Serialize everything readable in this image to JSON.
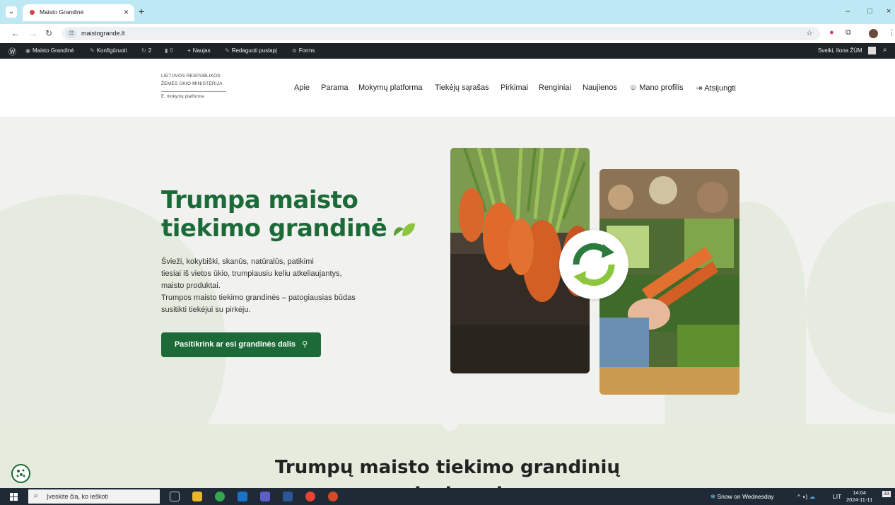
{
  "browser": {
    "tab_title": "Maisto Grandinė",
    "tab_close": "×",
    "new_tab": "+",
    "url": "maistogrande.lt",
    "controls": {
      "minimize": "–",
      "maximize": "□",
      "close": "×"
    }
  },
  "admin_bar": {
    "site_name": "Maisto Grandinė",
    "customize": "Konfigūruoti",
    "updates_count": "2",
    "comments_count": "0",
    "new_label": "Naujas",
    "edit_page": "Redaguoti puslapį",
    "forms": "Forms",
    "greeting": "Sveiki, Ilona ŽŪM"
  },
  "header": {
    "logo_line1": "LIETUVOS RESPUBLIKOS",
    "logo_line2": "ŽEMĖS ŪKIO MINISTERIJA",
    "logo_sub": "E. mokymų platforma",
    "nav": [
      "Apie",
      "Parama",
      "Mokymų platforma",
      "Tiekėjų sąrašas",
      "Pirkimai",
      "Renginiai",
      "Naujienos",
      "Mano profilis",
      "Atsijungti"
    ]
  },
  "hero": {
    "title_line1": "Trumpa maisto",
    "title_line2": "tiekimo grandinė",
    "text_lines": [
      "Švieži, kokybiški, skanūs, natūralūs, patikimi",
      "tiesiai iš vietos ūkio, trumpiausiu keliu atkeliaujantys,",
      "maisto produktai.",
      "Trumpos maisto tiekimo grandinės – patogiausias būdas",
      "susitikti tiekėjui su pirkėju."
    ],
    "cta_label": "Pasitikrink ar esi grandinės dalis"
  },
  "section2": {
    "title_line1": "Trumpų maisto tiekimo grandinių",
    "title_line2": "privalumai"
  },
  "taskbar": {
    "search_placeholder": "Įveskite čia, ko ieškoti",
    "weather": "Snow on Wednesday",
    "lang": "LIT",
    "time": "14:04",
    "date": "2024-11-11",
    "notifications": "33"
  },
  "colors": {
    "brand_green": "#1d6a39",
    "hero_bg": "#f1f1ef",
    "section_bg": "#e5ebdd",
    "tabstrip": "#bee8f3",
    "adminbar": "#1d2327"
  }
}
